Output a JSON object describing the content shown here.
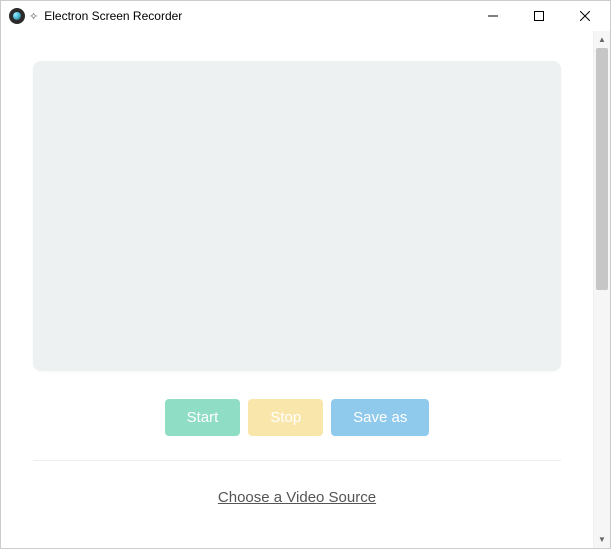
{
  "window": {
    "title": "Electron Screen Recorder"
  },
  "controls": {
    "start_label": "Start",
    "stop_label": "Stop",
    "save_label": "Save as"
  },
  "footer": {
    "choose_source_label": "Choose a Video Source"
  },
  "colors": {
    "start_button": "#8fddc4",
    "stop_button": "#f9e6aa",
    "save_button": "#8fc9ec",
    "preview_bg": "#eef1f1"
  }
}
